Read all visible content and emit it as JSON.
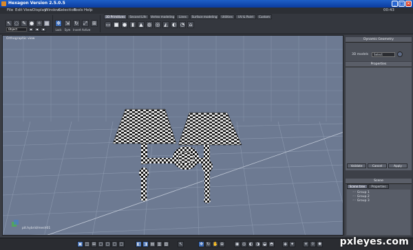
{
  "window": {
    "title": "Hexagon Version 2.5.0.5",
    "controls": [
      "_",
      "□",
      "✕"
    ]
  },
  "menu": [
    "File",
    "Edit",
    "View",
    "Display",
    "Window",
    "Selection",
    "Tools",
    "Help"
  ],
  "clock": "00:43",
  "toolbar": {
    "mode_select": "Object",
    "left_labels": [
      "Lock",
      "Sym",
      "Invert",
      "Active"
    ],
    "tabs": [
      "3D Primitives",
      "Second Life",
      "Vertex modeling",
      "Lines",
      "Surface modeling",
      "Utilities",
      "UV & Paint",
      "Custom"
    ],
    "active_tab": 0
  },
  "viewport": {
    "label": "Orthographic view",
    "coord_text": "pit.hybrid/mesh01"
  },
  "right_panel": {
    "dynamic_geometry": {
      "title": "Dynamic Geometry",
      "mode_label": "3D models",
      "dropdown": "Select"
    },
    "properties": {
      "title": "Properties",
      "buttons": [
        "Validate",
        "Cancel",
        "Apply"
      ]
    },
    "scene": {
      "title": "Scene",
      "tabs": [
        "Scene tree",
        "Properties"
      ],
      "items": [
        "Group 1",
        "Group 2",
        "Group 3"
      ]
    }
  },
  "watermark": "pxleyes.com",
  "colors": {
    "titlebar": "#1e5fc7",
    "viewport_bg": "#6d7a92",
    "grid": "#8b98ae",
    "accent_blue": "#3d6db8"
  }
}
